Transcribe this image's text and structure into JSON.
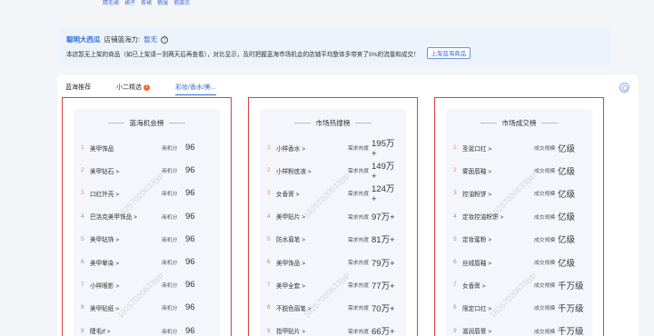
{
  "top_tags": [
    "精毛裙",
    "裙子",
    "茶裙",
    "裤服",
    "假莱衣"
  ],
  "shop": {
    "name": "聪明大西瓜",
    "potential_label": "店铺蓝海力:",
    "potential_value": "暂无",
    "notice": "本店暂无上架的商品（如已上架请一到两天后再查看），对比显示，及时把握蓝海市场机会的店铺平均整体多带来了5%的流量和成交！",
    "button_label": "上架蓝海商品"
  },
  "tabs": [
    {
      "label": "蓝海推荐",
      "badge": ""
    },
    {
      "label": "小二精选",
      "badge": "1"
    },
    {
      "label": "彩妆/香水/美...",
      "badge": ""
    }
  ],
  "watermark": "18257020633jyp",
  "boards": [
    {
      "title": "蓝海机会榜",
      "metric_label": "商机分",
      "rows": [
        {
          "rank": "1",
          "name": "美甲饰品",
          "value": "96"
        },
        {
          "rank": "2",
          "name": "美甲钻石 >",
          "value": "96"
        },
        {
          "rank": "3",
          "name": "口红外壳 >",
          "value": "96"
        },
        {
          "rank": "4",
          "name": "巴洛克美甲饰品 >",
          "value": "96"
        },
        {
          "rank": "5",
          "name": "美甲钻饰 >",
          "value": "96"
        },
        {
          "rank": "6",
          "name": "美甲晕染 >",
          "value": "96"
        },
        {
          "rank": "7",
          "name": "小样眼影 >",
          "value": "96"
        },
        {
          "rank": "8",
          "name": "美甲贴纸 >",
          "value": "96"
        },
        {
          "rank": "9",
          "name": "睫毛tf >",
          "value": "96"
        }
      ]
    },
    {
      "title": "市场热搜榜",
      "metric_label": "需求热度",
      "rows": [
        {
          "rank": "1",
          "name": "小样香水 >",
          "value": "195万+"
        },
        {
          "rank": "2",
          "name": "小样粉底液 >",
          "value": "149万+"
        },
        {
          "rank": "3",
          "name": "女香膏 >",
          "value": "124万+"
        },
        {
          "rank": "4",
          "name": "美甲贴片 >",
          "value": "97万+"
        },
        {
          "rank": "5",
          "name": "防水眉笔 >",
          "value": "81万+"
        },
        {
          "rank": "6",
          "name": "美甲饰品 >",
          "value": "79万+"
        },
        {
          "rank": "7",
          "name": "美甲全套 >",
          "value": "77万+"
        },
        {
          "rank": "8",
          "name": "不脱色眉笔 >",
          "value": "70万+"
        },
        {
          "rank": "9",
          "name": "指甲贴片 >",
          "value": "66万+"
        }
      ]
    },
    {
      "title": "市场成交榜",
      "metric_label": "成交规模",
      "rows": [
        {
          "rank": "1",
          "name": "圣诞口红 >",
          "value": "亿级"
        },
        {
          "rank": "2",
          "name": "雾面唇釉 >",
          "value": "亿级"
        },
        {
          "rank": "3",
          "name": "控油粉饼 >",
          "value": "亿级"
        },
        {
          "rank": "4",
          "name": "定妆控油粉饼 >",
          "value": "亿级"
        },
        {
          "rank": "5",
          "name": "定妆蜜粉 >",
          "value": "亿级"
        },
        {
          "rank": "6",
          "name": "丝绒唇釉 >",
          "value": "亿级"
        },
        {
          "rank": "7",
          "name": "女香膏 >",
          "value": "千万级"
        },
        {
          "rank": "8",
          "name": "限定口红 >",
          "value": "千万级"
        },
        {
          "rank": "9",
          "name": "滋润唇膏 >",
          "value": "千万级"
        }
      ]
    }
  ]
}
